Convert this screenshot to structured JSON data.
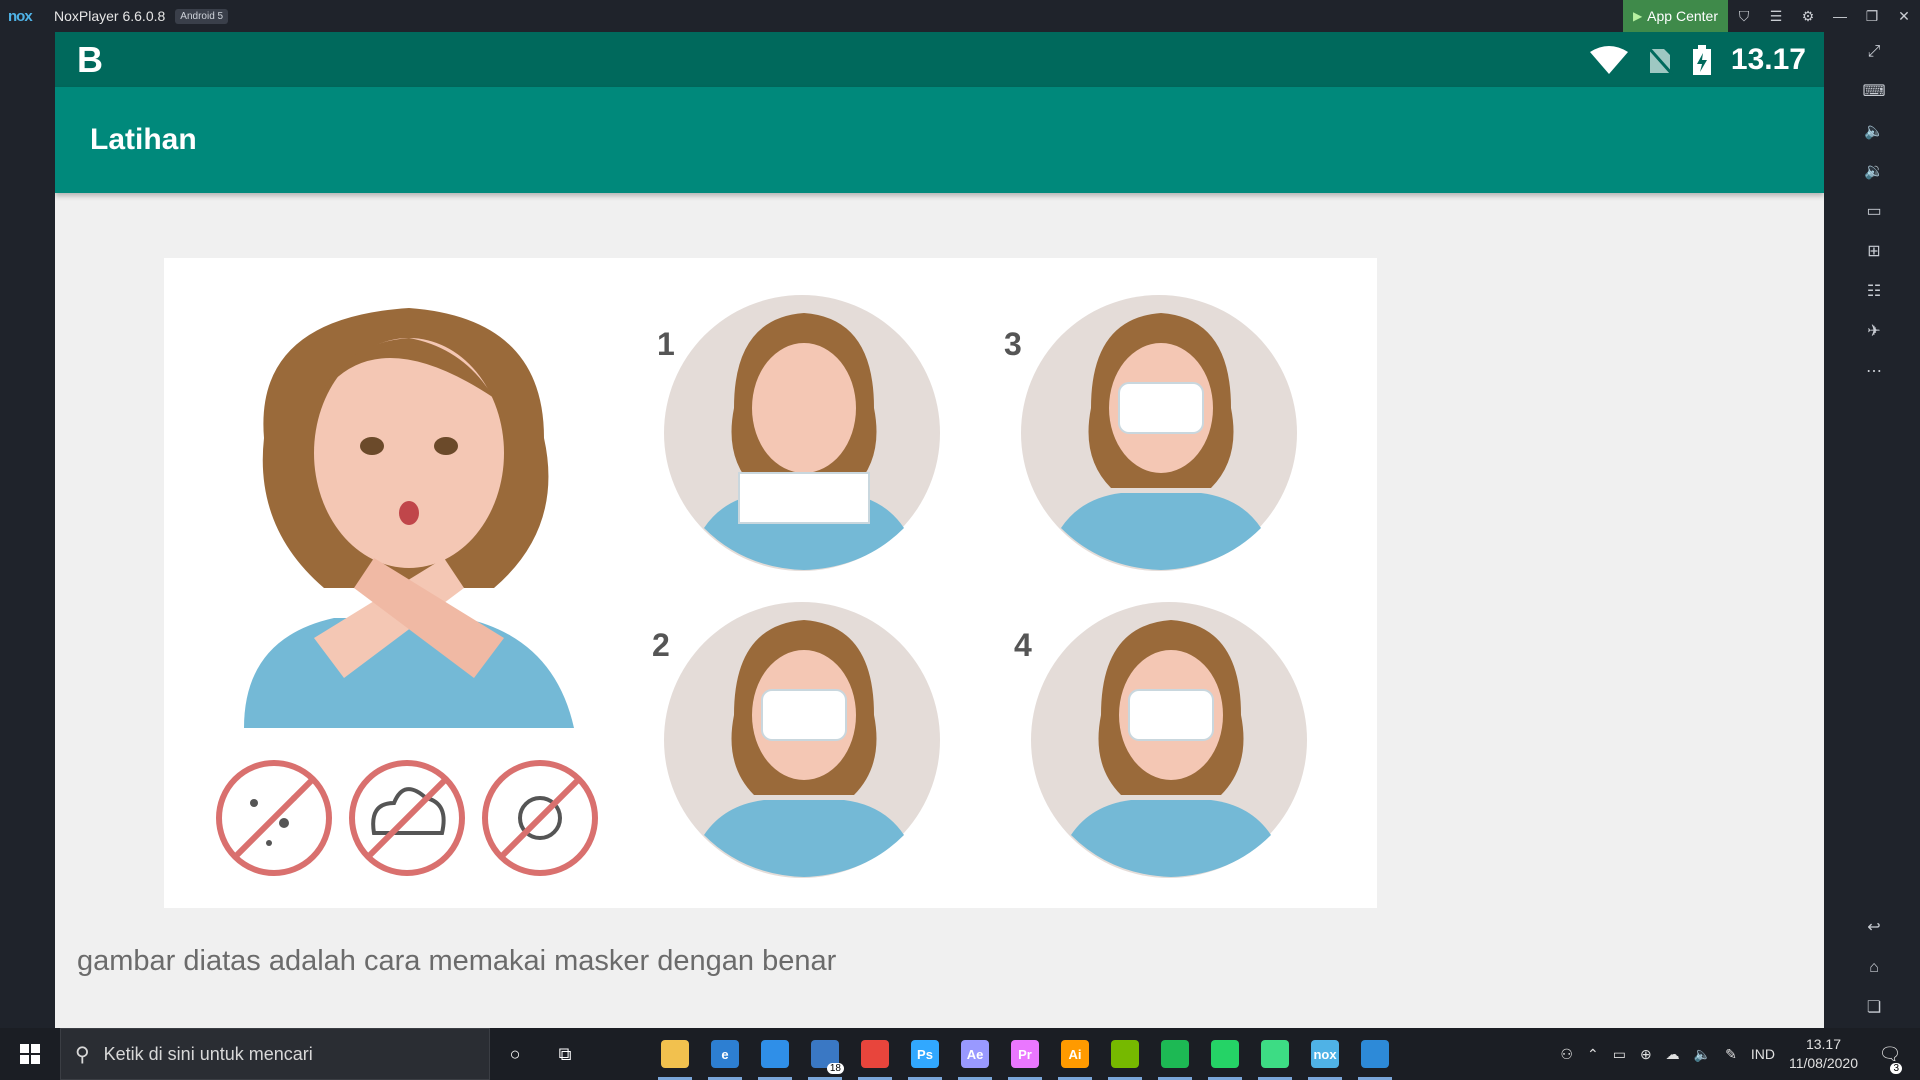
{
  "window": {
    "logo": "nox",
    "title": "NoxPlayer 6.6.0.8",
    "android_badge": "Android 5",
    "app_center_label": "App Center",
    "title_icons": [
      "tshirt-icon",
      "menu-icon",
      "gear-icon",
      "minimize-icon",
      "restore-icon",
      "close-icon"
    ]
  },
  "sidebar": {
    "icons": [
      "fullscreen-icon",
      "keyboard-icon",
      "volume-up-icon",
      "volume-down-icon",
      "screen-icon",
      "add-apk-icon",
      "multi-instance-icon",
      "rocket-icon",
      "more-icon",
      "back-icon",
      "home-icon",
      "recents-icon"
    ]
  },
  "android": {
    "status": {
      "logo": "B",
      "time": "13.17",
      "icons": [
        "wifi-icon",
        "no-sim-icon",
        "battery-charging-icon"
      ]
    },
    "appbar": {
      "title": "Latihan"
    },
    "illustration": {
      "step_labels": [
        "1",
        "2",
        "3",
        "4"
      ]
    },
    "caption": "gambar diatas adalah cara memakai masker dengan benar"
  },
  "taskbar": {
    "search_placeholder": "Ketik di sini untuk mencari",
    "apps": [
      {
        "name": "file-explorer",
        "label": "",
        "color": "#f2c14e"
      },
      {
        "name": "edge",
        "label": "e",
        "color": "#2d7fd2"
      },
      {
        "name": "vscode",
        "label": "",
        "color": "#2f8fe8"
      },
      {
        "name": "mail",
        "label": "",
        "color": "#3a78c4",
        "badge": "18"
      },
      {
        "name": "chrome",
        "label": "",
        "color": "#e8453c"
      },
      {
        "name": "photoshop",
        "label": "Ps",
        "color": "#31a8ff"
      },
      {
        "name": "after-effects",
        "label": "Ae",
        "color": "#9999ff"
      },
      {
        "name": "premiere",
        "label": "Pr",
        "color": "#ea77ff"
      },
      {
        "name": "illustrator",
        "label": "Ai",
        "color": "#ff9a00"
      },
      {
        "name": "app-circle",
        "label": "",
        "color": "#76b900"
      },
      {
        "name": "spotify",
        "label": "",
        "color": "#1db954"
      },
      {
        "name": "whatsapp",
        "label": "",
        "color": "#25d366"
      },
      {
        "name": "android-studio",
        "label": "",
        "color": "#3ddc84"
      },
      {
        "name": "nox",
        "label": "nox",
        "color": "#4fb2e6"
      },
      {
        "name": "photos",
        "label": "",
        "color": "#2d8ad8"
      }
    ],
    "language": "IND",
    "time": "13.17",
    "date": "11/08/2020",
    "notifications": "3"
  }
}
